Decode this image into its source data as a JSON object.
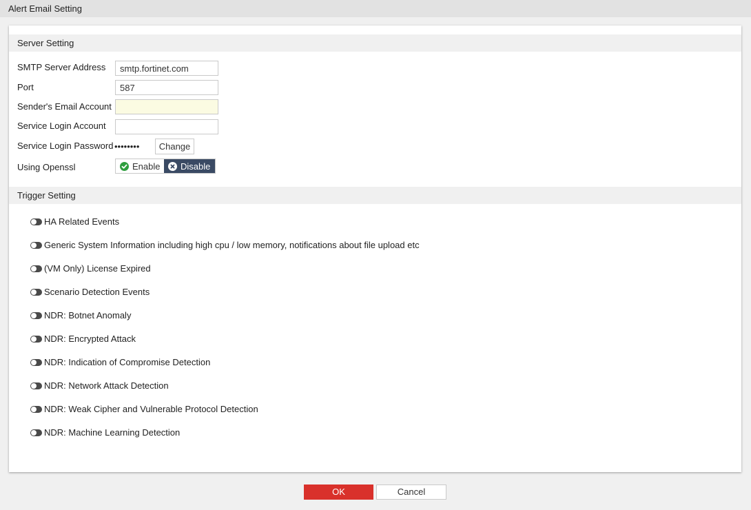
{
  "dialog": {
    "title": "Alert Email Setting"
  },
  "server_setting": {
    "header": "Server Setting",
    "smtp_label": "SMTP Server Address",
    "smtp_value": "smtp.fortinet.com",
    "port_label": "Port",
    "port_value": "587",
    "sender_label": "Sender's Email Account",
    "sender_value": "",
    "login_account_label": "Service Login Account",
    "login_account_value": "",
    "login_password_label": "Service Login Password",
    "login_password_mask": "••••••••",
    "change_button": "Change",
    "openssl_label": "Using Openssl",
    "enable_label": "Enable",
    "disable_label": "Disable",
    "openssl_selected": "Disable"
  },
  "trigger_setting": {
    "header": "Trigger Setting",
    "items": [
      {
        "label": "HA Related Events",
        "enabled": false
      },
      {
        "label": "Generic System Information including high cpu / low memory, notifications about file upload etc",
        "enabled": false
      },
      {
        "label": "(VM Only) License Expired",
        "enabled": false
      },
      {
        "label": "Scenario Detection Events",
        "enabled": false
      },
      {
        "label": "NDR: Botnet Anomaly",
        "enabled": false
      },
      {
        "label": "NDR: Encrypted Attack",
        "enabled": false
      },
      {
        "label": "NDR: Indication of Compromise Detection",
        "enabled": false
      },
      {
        "label": "NDR: Network Attack Detection",
        "enabled": false
      },
      {
        "label": "NDR: Weak Cipher and Vulnerable Protocol Detection",
        "enabled": false
      },
      {
        "label": "NDR: Machine Learning Detection",
        "enabled": false
      }
    ]
  },
  "footer": {
    "ok_label": "OK",
    "cancel_label": "Cancel"
  },
  "colors": {
    "ok_button": "#d9312b",
    "disable_selected": "#3a4a64",
    "enable_check": "#2e9e3e",
    "sender_field_bg": "#fbfbe2"
  },
  "icons": {
    "enable": "check-circle-icon",
    "disable": "x-circle-icon",
    "trigger_toggle": "toggle-off-icon"
  }
}
